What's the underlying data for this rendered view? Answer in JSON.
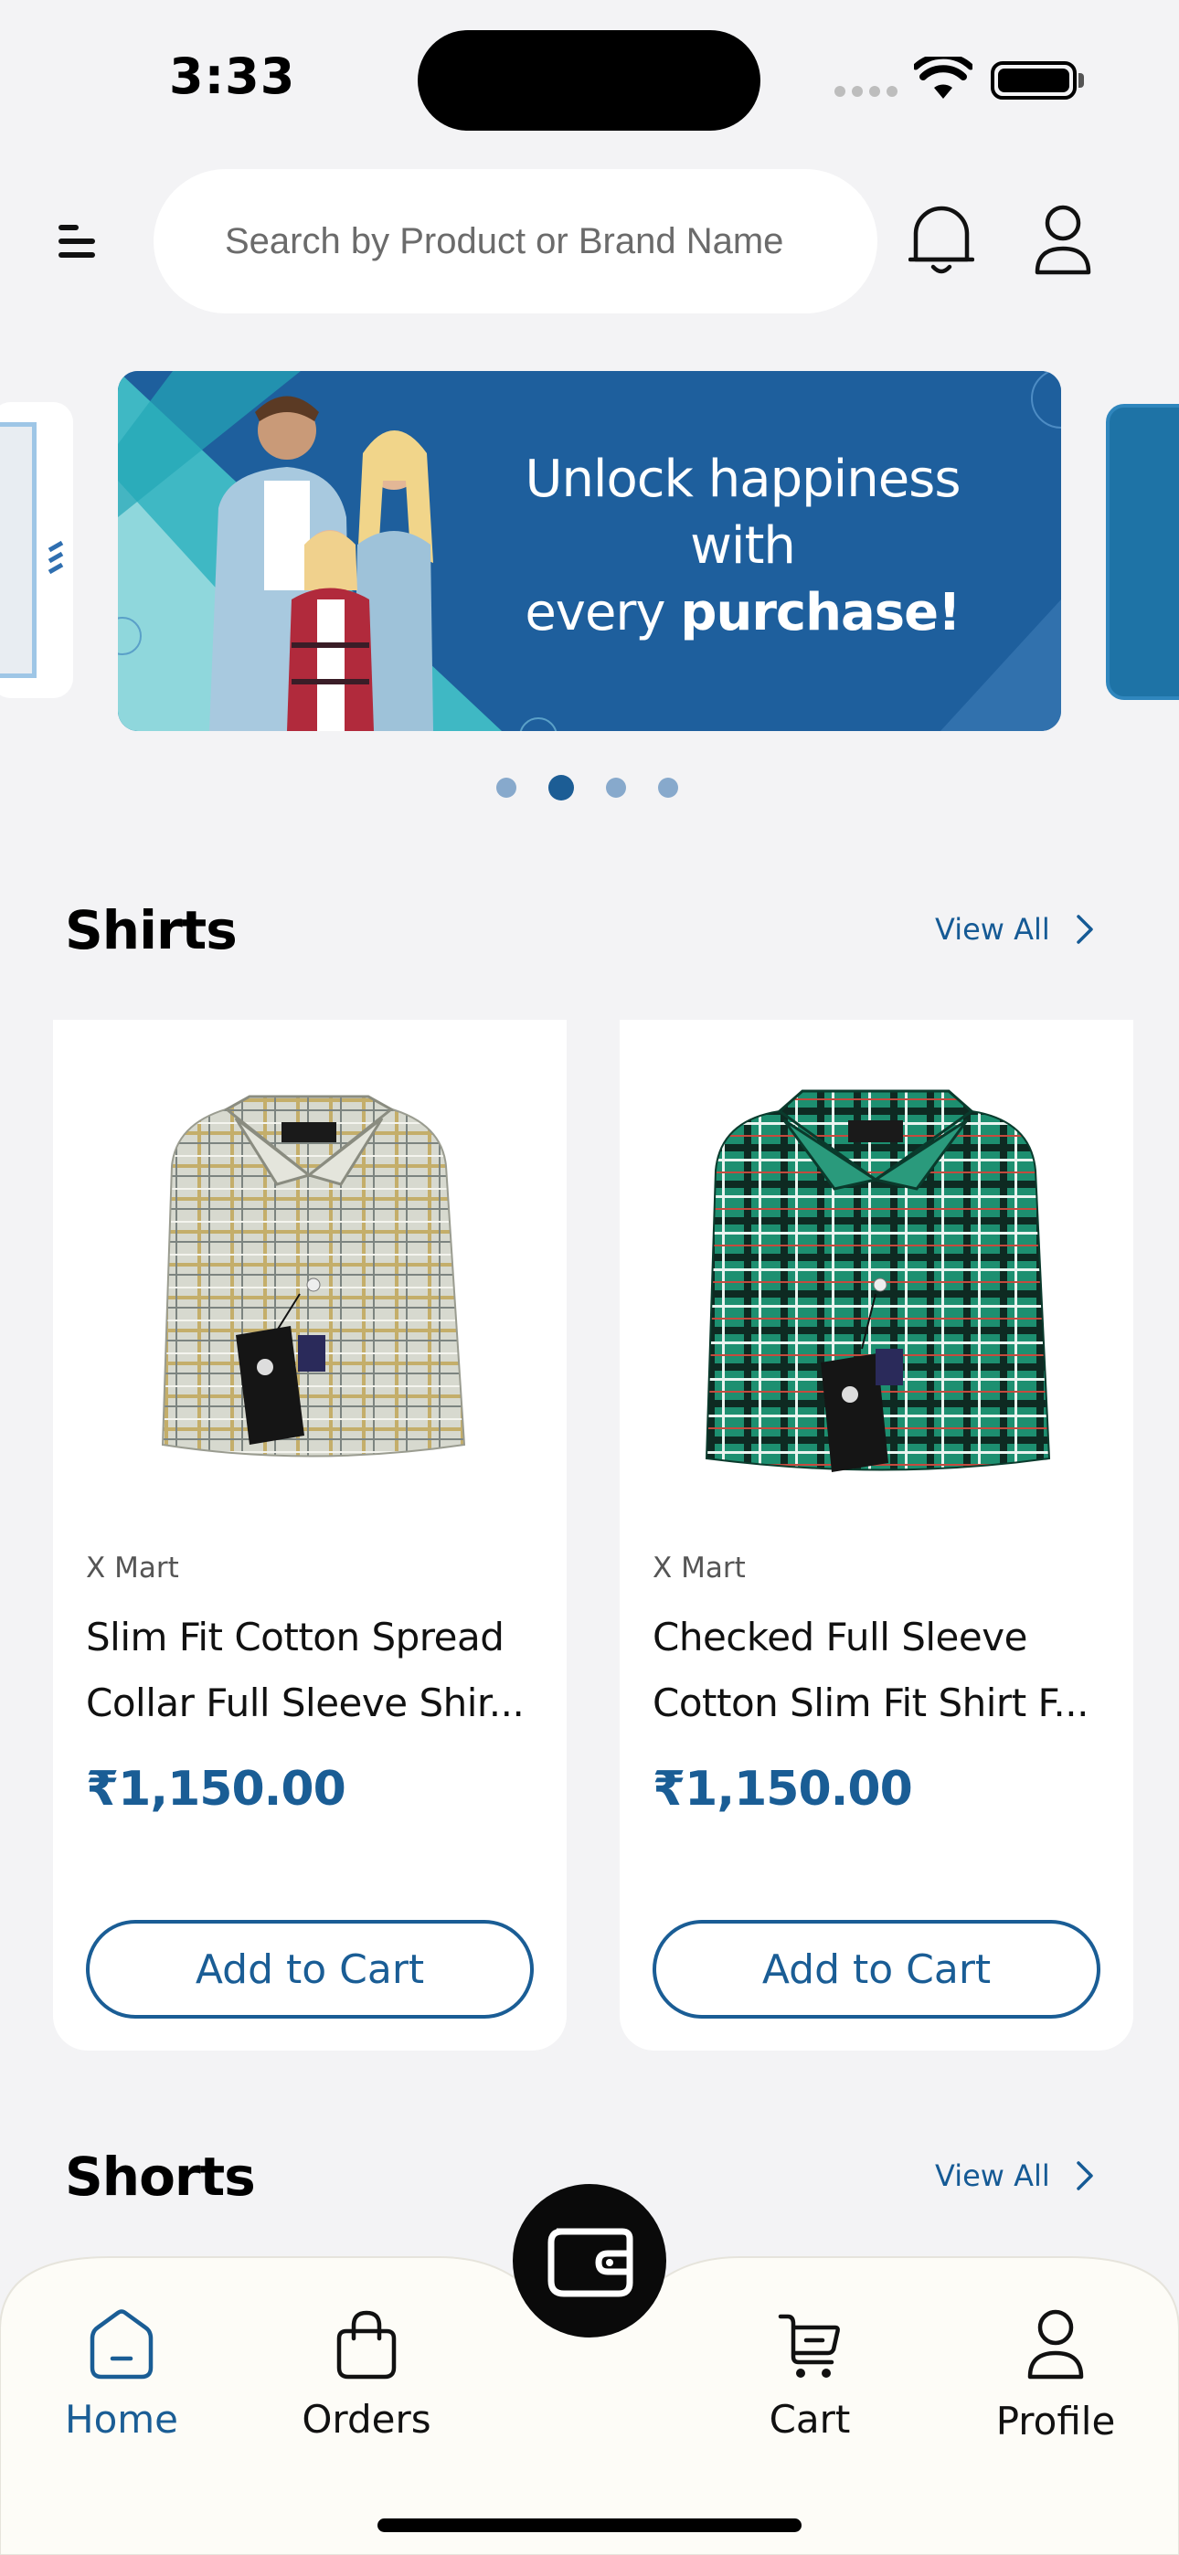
{
  "status_bar": {
    "time": "3:33"
  },
  "header": {
    "search_placeholder": "Search by Product or Brand Name"
  },
  "banner": {
    "line1": "Unlock happiness",
    "line2": "with",
    "line3_normal": "every ",
    "line3_bold": "purchase!",
    "active_dot": 2,
    "dot_count": 4
  },
  "sections": [
    {
      "title": "Shirts",
      "view_all": "View All",
      "products": [
        {
          "brand": "X Mart",
          "name_line1": "Slim Fit Cotton Spread",
          "name_line2": "Collar Full Sleeve Shir...",
          "price": "₹1,150.00",
          "button": "Add to Cart",
          "color": "#cfd2c4"
        },
        {
          "brand": "X Mart",
          "name_line1": "Checked Full Sleeve",
          "name_line2": "Cotton Slim Fit Shirt F...",
          "price": "₹1,150.00",
          "button": "Add to Cart",
          "color": "#1f8c6e"
        }
      ]
    },
    {
      "title": "Shorts",
      "view_all": "View All"
    }
  ],
  "bottom_nav": {
    "items": [
      {
        "label": "Home",
        "icon": "home-icon",
        "active": true
      },
      {
        "label": "Orders",
        "icon": "bag-icon",
        "active": false
      },
      {
        "label": "Cart",
        "icon": "cart-icon",
        "active": false
      },
      {
        "label": "Profile",
        "icon": "profile-icon",
        "active": false
      }
    ],
    "center_button_icon": "wallet-icon"
  },
  "colors": {
    "accent": "#1a5d95",
    "background": "#f3f3f5",
    "banner": "#1e5f9d"
  }
}
